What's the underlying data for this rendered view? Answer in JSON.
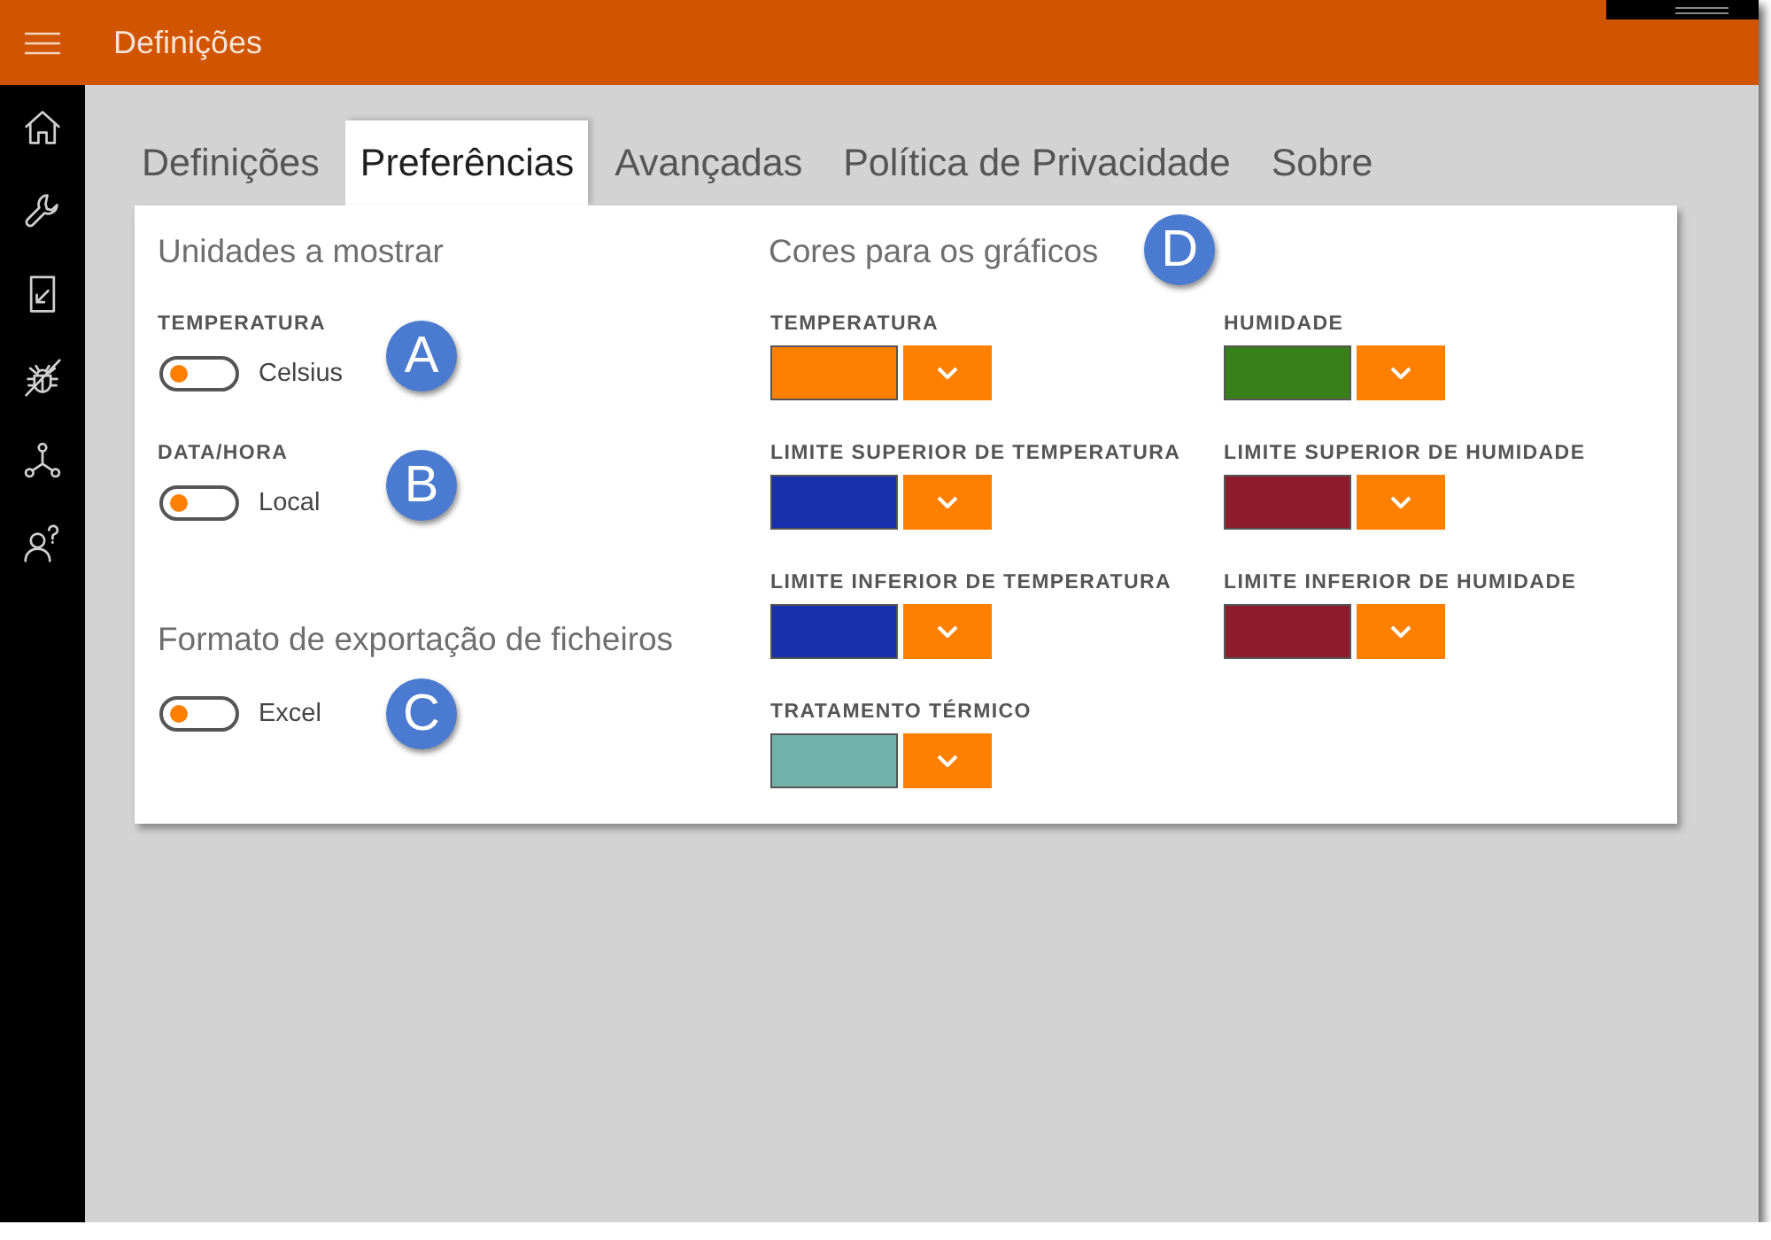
{
  "app_bar": {
    "title": "Definições"
  },
  "tabs": [
    {
      "label": "Definições",
      "selected": false
    },
    {
      "label": "Preferências",
      "selected": true
    },
    {
      "label": "Avançadas",
      "selected": false
    },
    {
      "label": "Política de Privacidade",
      "selected": false
    },
    {
      "label": "Sobre",
      "selected": false
    }
  ],
  "units": {
    "heading": "Unidades a mostrar",
    "settings": [
      {
        "label": "TEMPERATURA",
        "on": false,
        "value": "Celsius",
        "marker": "A"
      },
      {
        "label": "DATA/HORA",
        "on": false,
        "value": "Local",
        "marker": "B"
      }
    ]
  },
  "export": {
    "heading": "Formato de exportação de ficheiros",
    "setting": {
      "on": false,
      "value": "Excel",
      "marker": "C"
    }
  },
  "chart_colors": {
    "heading": "Cores para os gráficos",
    "marker": "D",
    "items": [
      {
        "label": "TEMPERATURA",
        "color": "#ff8000"
      },
      {
        "label": "HUMIDADE",
        "color": "#37801a"
      },
      {
        "label": "LIMITE SUPERIOR DE TEMPERATURA",
        "color": "#1530aa"
      },
      {
        "label": "LIMITE SUPERIOR DE HUMIDADE",
        "color": "#8e1b2b"
      },
      {
        "label": "LIMITE INFERIOR DE TEMPERATURA",
        "color": "#1530aa"
      },
      {
        "label": "LIMITE INFERIOR DE HUMIDADE",
        "color": "#8e1b2b"
      },
      {
        "label": "TRATAMENTO TÉRMICO",
        "color": "#72b2aa"
      }
    ]
  }
}
